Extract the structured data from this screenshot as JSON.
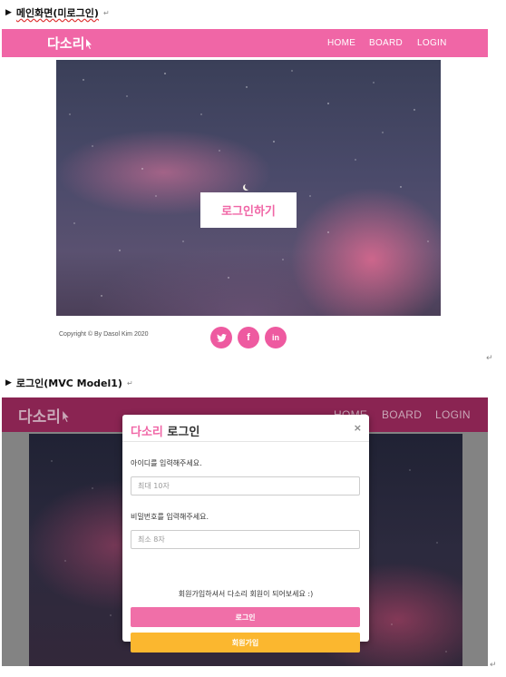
{
  "doc": {
    "heading1": "메인화면(미로그인)",
    "heading2": "로그인(MVC Model1)",
    "para_mark": "↵",
    "bullet": "▶"
  },
  "main_screen": {
    "logo": "다소리",
    "nav": [
      "HOME",
      "BOARD",
      "LOGIN"
    ],
    "login_button": "로그인하기",
    "copyright": "Copyright © By Dasol Kim 2020",
    "social_icons": [
      "twitter-icon",
      "facebook-icon",
      "linkedin-icon"
    ],
    "colors": {
      "accent": "#f066a6",
      "social": "#ee5aa0"
    }
  },
  "login_screen": {
    "logo": "다소리",
    "nav": [
      "HOME",
      "BOARD",
      "LOGIN"
    ],
    "modal": {
      "title_accent": "다소리",
      "title_rest": "로그인",
      "close": "×",
      "id_label": "아이디를 입력해주세요.",
      "id_placeholder": "최대 10자",
      "pw_label": "비밀번호를 입력해주세요.",
      "pw_placeholder": "최소 8자",
      "signup_note": "회원가입하셔서 다소리 회원이 되어보세요 :)",
      "login_button": "로그인",
      "signup_button": "회원가입"
    },
    "colors": {
      "nav_dim": "#8a2452",
      "login_btn": "#f06fa8",
      "signup_btn": "#fbb72f"
    }
  }
}
